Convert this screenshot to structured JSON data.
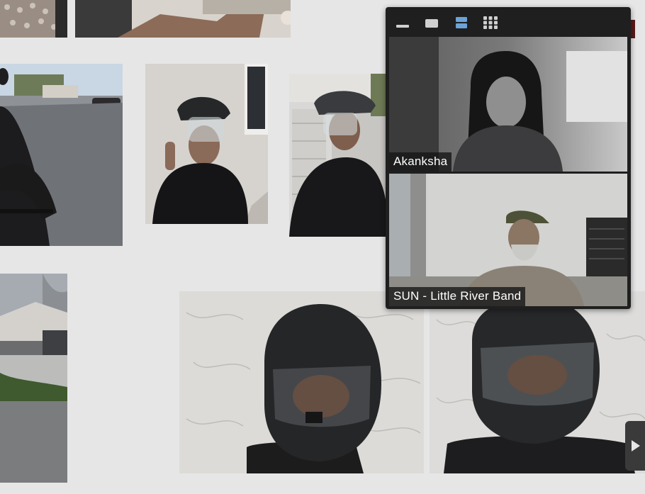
{
  "gallery": {
    "photos": [
      {
        "name": "photo-lace-top-left",
        "description_tag": "lace-cloth"
      },
      {
        "name": "photo-hand-top",
        "description_tag": "hand-on-fabric"
      },
      {
        "name": "photo-bike-street",
        "description_tag": "cyclist-on-street"
      },
      {
        "name": "photo-bike-helmet-faceshield-1",
        "description_tag": "woman-bike-helmet-faceshield"
      },
      {
        "name": "photo-bike-helmet-faceshield-2",
        "description_tag": "woman-bike-helmet-garage"
      },
      {
        "name": "photo-house-street",
        "description_tag": "house-street"
      },
      {
        "name": "photo-motorcycle-helmet-1",
        "description_tag": "motorcycle-helmet-stucco"
      },
      {
        "name": "photo-motorcycle-helmet-2",
        "description_tag": "motorcycle-helmet-stucco"
      }
    ]
  },
  "call": {
    "toolbar": {
      "buttons": [
        {
          "icon": "minimize-icon"
        },
        {
          "icon": "single-view-icon"
        },
        {
          "icon": "stacked-view-icon"
        },
        {
          "icon": "grid-view-icon"
        }
      ],
      "active_color": "#6aa3d8"
    },
    "participants": [
      {
        "name": "Akanksha"
      },
      {
        "name": "SUN - Little River Band"
      }
    ]
  },
  "navigation": {
    "next_icon": "chevron-right-icon"
  }
}
